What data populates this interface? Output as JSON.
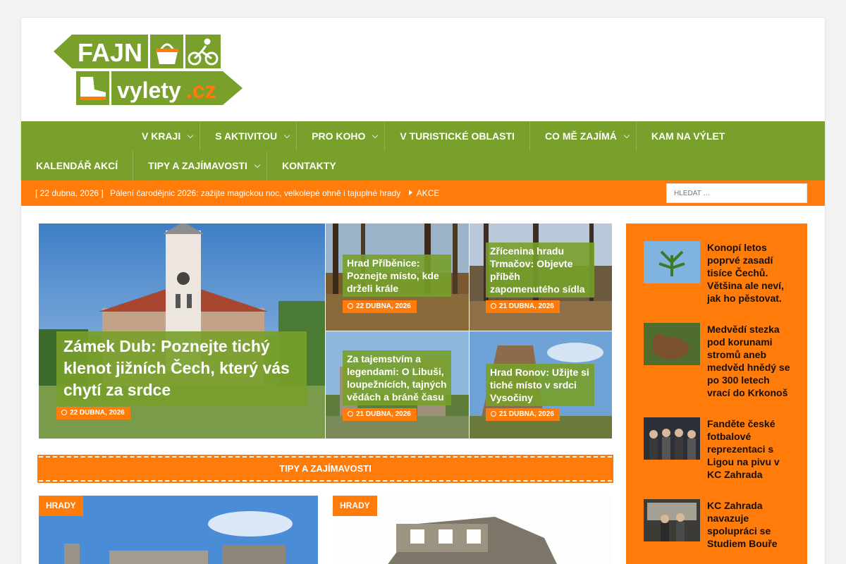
{
  "logo": {
    "line1": "FAJN",
    "line2": "vylety",
    "tld": ".cz"
  },
  "nav": {
    "row1": [
      {
        "label": "V kraji",
        "sub": true
      },
      {
        "label": "S aktivitou",
        "sub": true
      },
      {
        "label": "Pro koho",
        "sub": true
      },
      {
        "label": "V turistické oblasti",
        "sub": false
      },
      {
        "label": "Co mě zajímá",
        "sub": true
      },
      {
        "label": "Kam na výlet",
        "sub": false
      }
    ],
    "row2": [
      {
        "label": "Kalendář akcí",
        "sub": false
      },
      {
        "label": "Tipy a zajímavosti",
        "sub": true
      },
      {
        "label": "Kontakty",
        "sub": false
      }
    ]
  },
  "ticker": {
    "date": "[ 22 dubna, 2026 ]",
    "headline": "Pálení čarodějnic 2026: zažijte magickou noc, velkolepé ohně i tajuplné hrady",
    "category": "AKCE"
  },
  "search": {
    "placeholder": "HLEDAT …"
  },
  "featured": {
    "main": {
      "title": "Zámek Dub: Poznejte tichý klenot jižních Čech, který vás chytí za srdce",
      "date": "22 DUBNA, 2026"
    },
    "t1": {
      "title": "Hrad Příběnice: Poznejte místo, kde drželi krále",
      "date": "22 DUBNA, 2026"
    },
    "t2": {
      "title": "Zřícenina hradu Trmačov: Objevte příběh zapomenutého sídla",
      "date": "21 DUBNA, 2026"
    },
    "t3": {
      "title": "Za tajemstvím a legendami: O Libuši, loupežnících, tajných vědách a bráně času",
      "date": "21 DUBNA, 2026"
    },
    "t4": {
      "title": "Hrad Ronov: Užijte si tiché místo v srdci Vysočiny",
      "date": "21 DUBNA, 2026"
    }
  },
  "section": {
    "title": "TIPY A ZAJÍMAVOSTI"
  },
  "cards": [
    {
      "category": "HRADY"
    },
    {
      "category": "HRADY"
    }
  ],
  "sidebar": [
    {
      "title": "Konopí letos poprvé zasadí tisíce Čechů. Většina ale neví, jak ho pěstovat."
    },
    {
      "title": "Medvědí stezka pod korunami stromů aneb medvěd hnědý se po 300 letech vrací do Krkonoš"
    },
    {
      "title": "Fanděte české fotbalové reprezentaci s Ligou na pivu v KC Zahrada"
    },
    {
      "title": "KC Zahrada navazuje spolupráci se Studiem Bouře"
    }
  ],
  "colors": {
    "green": "#78a02a",
    "orange": "#ff7b0a"
  }
}
